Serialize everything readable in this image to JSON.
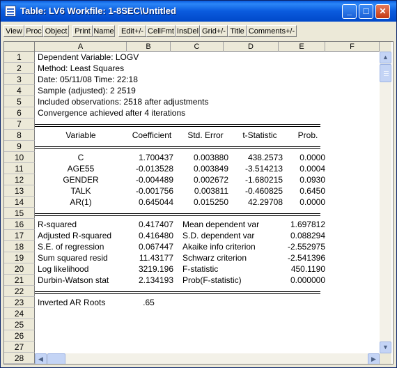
{
  "window": {
    "title": "Table: LV6   Workfile: 1-8SEC\\Untitled",
    "app_icon": "table-icon",
    "controls": [
      {
        "name": "minimize",
        "icon": "minimize-icon",
        "glyph": "_"
      },
      {
        "name": "maximize",
        "icon": "maximize-icon",
        "glyph": "□"
      },
      {
        "name": "close",
        "icon": "close-icon",
        "glyph": "✕"
      }
    ],
    "colors": {
      "titlebar": "#0A5BDE",
      "close": "#C43912",
      "chrome": "#ECE9D8"
    }
  },
  "toolbar": {
    "buttons": [
      "View",
      "Proc",
      "Object",
      "Print",
      "Name",
      "Edit+/-",
      "CellFmt",
      "InsDel",
      "Grid+/-",
      "Title",
      "Comments+/-"
    ]
  },
  "sheet": {
    "columns": [
      "A",
      "B",
      "C",
      "D",
      "E",
      "F"
    ],
    "rows": [
      {
        "n": "1",
        "a": "Dependent Variable: LOGV"
      },
      {
        "n": "2",
        "a": "Method: Least Squares"
      },
      {
        "n": "3",
        "a": "Date: 05/11/08   Time: 22:18"
      },
      {
        "n": "4",
        "a": "Sample (adjusted): 2 2519"
      },
      {
        "n": "5",
        "a": "Included observations: 2518 after adjustments"
      },
      {
        "n": "6",
        "a": "Convergence achieved after 4 iterations"
      },
      {
        "n": "7"
      },
      {
        "n": "8",
        "header": [
          "Variable",
          "Coefficient",
          "Std. Error",
          "t-Statistic",
          "Prob."
        ]
      },
      {
        "n": "9"
      },
      {
        "n": "10",
        "coef": [
          "C",
          "1.700437",
          "0.003880",
          "438.2573",
          "0.0000"
        ]
      },
      {
        "n": "11",
        "coef": [
          "AGE55",
          "-0.013528",
          "0.003849",
          "-3.514213",
          "0.0004"
        ]
      },
      {
        "n": "12",
        "coef": [
          "GENDER",
          "-0.004489",
          "0.002672",
          "-1.680215",
          "0.0930"
        ]
      },
      {
        "n": "13",
        "coef": [
          "TALK",
          "-0.001756",
          "0.003811",
          "-0.460825",
          "0.6450"
        ]
      },
      {
        "n": "14",
        "coef": [
          "AR(1)",
          "0.645044",
          "0.015250",
          "42.29708",
          "0.0000"
        ]
      },
      {
        "n": "15"
      },
      {
        "n": "16",
        "stat": [
          "R-squared",
          "0.417407",
          "Mean dependent var",
          "1.697812"
        ]
      },
      {
        "n": "17",
        "stat": [
          "Adjusted R-squared",
          "0.416480",
          "S.D. dependent var",
          "0.088294"
        ]
      },
      {
        "n": "18",
        "stat": [
          "S.E. of regression",
          "0.067447",
          "Akaike info criterion",
          "-2.552975"
        ]
      },
      {
        "n": "19",
        "stat": [
          "Sum squared resid",
          "11.43177",
          "Schwarz criterion",
          "-2.541396"
        ]
      },
      {
        "n": "20",
        "stat": [
          "Log likelihood",
          "3219.196",
          "F-statistic",
          "450.1190"
        ]
      },
      {
        "n": "21",
        "stat": [
          "Durbin-Watson stat",
          "2.134193",
          "Prob(F-statistic)",
          "0.000000"
        ]
      },
      {
        "n": "22"
      },
      {
        "n": "23",
        "roots": [
          "Inverted AR Roots",
          ".65"
        ]
      },
      {
        "n": "24"
      },
      {
        "n": "25"
      },
      {
        "n": "26"
      },
      {
        "n": "27"
      },
      {
        "n": "28"
      }
    ]
  },
  "scrollbars": {
    "up_icon": "scroll-up-arrow-icon",
    "down_icon": "scroll-down-arrow-icon",
    "left_icon": "scroll-left-arrow-icon",
    "right_icon": "scroll-right-arrow-icon"
  }
}
